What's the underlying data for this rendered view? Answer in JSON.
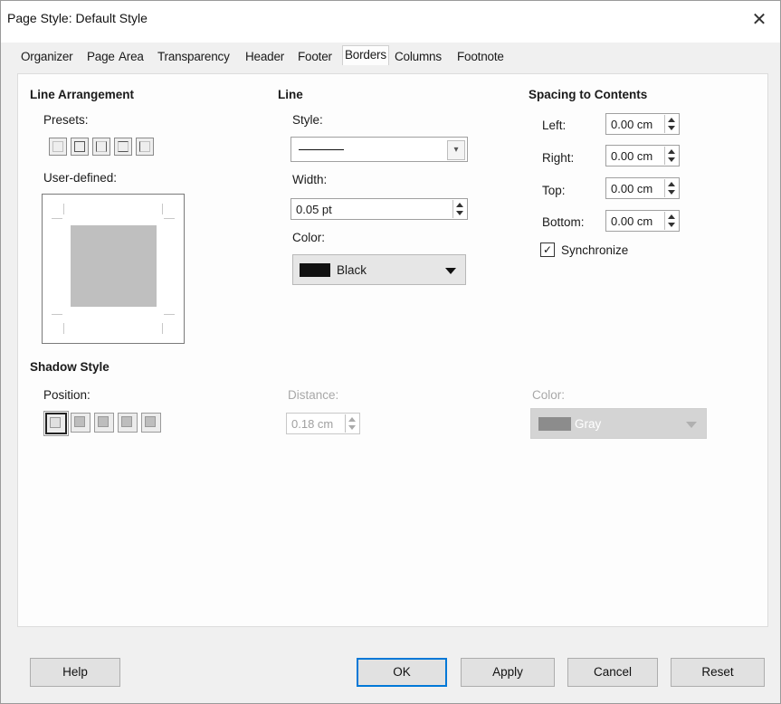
{
  "window": {
    "title": "Page Style: Default Style",
    "close_label": "✕"
  },
  "tabs": [
    "Organizer",
    "Page",
    "Area",
    "Transparency",
    "Header",
    "Footer",
    "Borders",
    "Columns",
    "Footnote"
  ],
  "active_tab": "Borders",
  "line_arrangement": {
    "heading": "Line Arrangement",
    "presets_label": "Presets:",
    "user_defined_label": "User-defined:"
  },
  "line": {
    "heading": "Line",
    "style_label": "Style:",
    "width_label": "Width:",
    "width_value": "0.05 pt",
    "color_label": "Color:",
    "color_value": "Black",
    "color_hex": "#111111"
  },
  "spacing": {
    "heading": "Spacing to Contents",
    "left_label": "Left:",
    "left_value": "0.00 cm",
    "right_label": "Right:",
    "right_value": "0.00 cm",
    "top_label": "Top:",
    "top_value": "0.00 cm",
    "bottom_label": "Bottom:",
    "bottom_value": "0.00 cm",
    "synchronize_label": "Synchronize",
    "synchronize_checked": true
  },
  "shadow": {
    "heading": "Shadow Style",
    "position_label": "Position:",
    "distance_label": "Distance:",
    "distance_value": "0.18 cm",
    "color_label": "Color:",
    "color_value": "Gray"
  },
  "buttons": {
    "help": "Help",
    "ok": "OK",
    "apply": "Apply",
    "cancel": "Cancel",
    "reset": "Reset"
  }
}
